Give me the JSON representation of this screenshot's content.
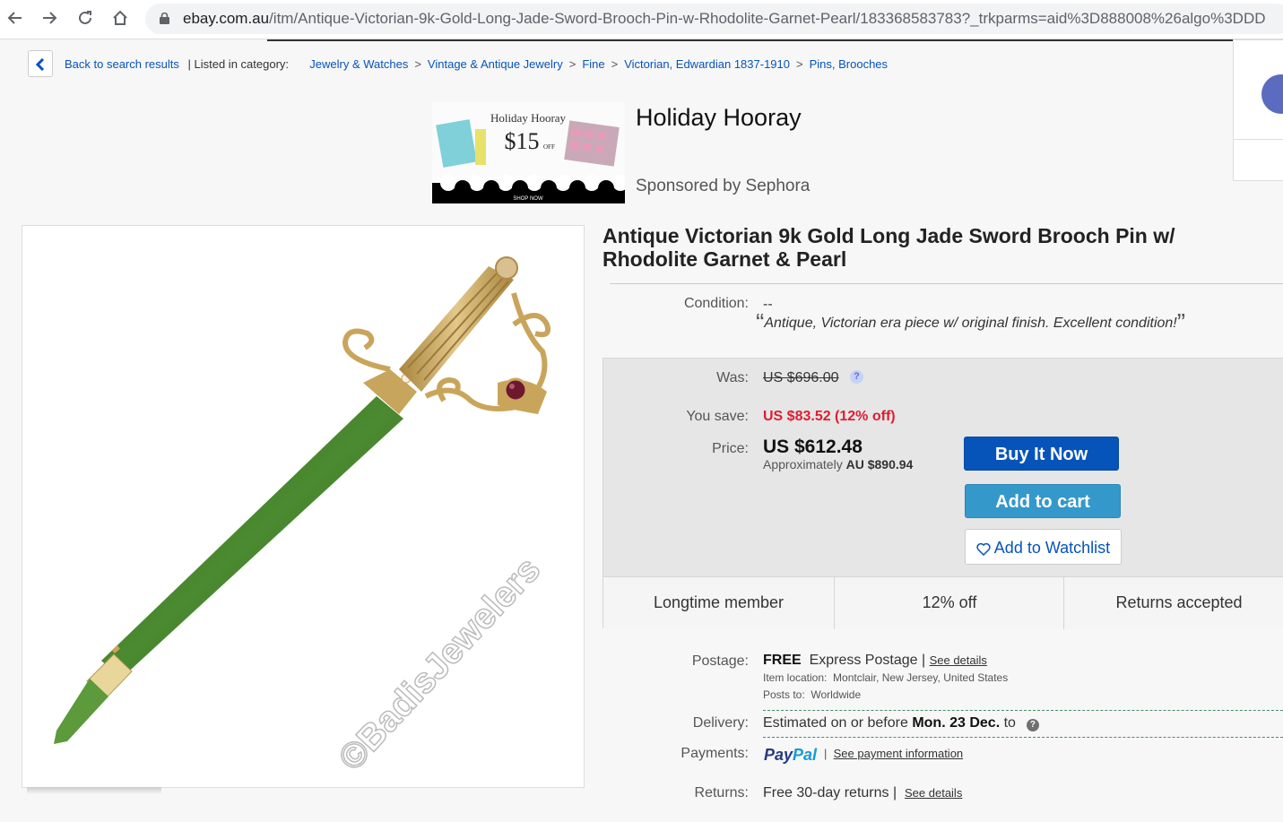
{
  "browser": {
    "url_domain": "ebay.com.au",
    "url_path": "/itm/Antique-Victorian-9k-Gold-Long-Jade-Sword-Brooch-Pin-w-Rhodolite-Garnet-Pearl/183368583783?_trkparms=aid%3D888008%26algo%3DDD"
  },
  "breadcrumb": {
    "back_label": "Back to search results",
    "listed_label": "| Listed in category:",
    "items": [
      "Jewelry & Watches",
      "Vintage & Antique Jewelry",
      "Fine",
      "Victorian, Edwardian 1837-1910",
      "Pins, Brooches"
    ],
    "separator": ">"
  },
  "ad": {
    "title": "Holiday Hooray",
    "sponsor": "Sponsored by Sephora",
    "image_title": "Holiday Hooray",
    "image_offer": "$15",
    "image_offer_suffix": "OFF",
    "image_cta": "SHOP NOW"
  },
  "watermark": "©BadisJewelers",
  "listing": {
    "title": "Antique Victorian 9k Gold Long Jade Sword Brooch Pin w/ Rhodolite Garnet & Pearl",
    "condition_label": "Condition:",
    "condition_value": "--",
    "condition_quote": "Antique, Victorian era piece w/ original finish. Excellent condition!"
  },
  "pricing": {
    "was_label": "Was:",
    "was_value": "US $696.00",
    "save_label": "You save:",
    "save_value": "US $83.52 (12% off)",
    "price_label": "Price:",
    "price_value": "US $612.48",
    "approx_prefix": "Approximately",
    "approx_value": "AU $890.94"
  },
  "actions": {
    "buy_now": "Buy It Now",
    "add_to_cart": "Add to cart",
    "watchlist": "Add to Watchlist"
  },
  "badges": [
    "Longtime member",
    "12% off",
    "Returns accepted"
  ],
  "shipping": {
    "postage_label": "Postage:",
    "postage_free": "FREE",
    "postage_type": "Express Postage |",
    "see_details": "See details",
    "item_location_label": "Item location:",
    "item_location": "Montclair, New Jersey, United States",
    "posts_to_label": "Posts to:",
    "posts_to": "Worldwide",
    "delivery_label": "Delivery:",
    "delivery_prefix": "Estimated on or before",
    "delivery_date": "Mon. 23 Dec.",
    "delivery_suffix": "to",
    "payments_label": "Payments:",
    "paypal_1": "Pay",
    "paypal_2": "Pal",
    "payment_link": "See payment information",
    "returns_label": "Returns:",
    "returns_value": "Free 30-day returns |",
    "returns_link": "See details"
  },
  "colors": {
    "link": "#0654ba",
    "buy_button": "#0654ba",
    "cart_button": "#3498ca",
    "save_red": "#dd1e31",
    "jade": "#3f7a2a",
    "gold": "#c9a55c"
  }
}
